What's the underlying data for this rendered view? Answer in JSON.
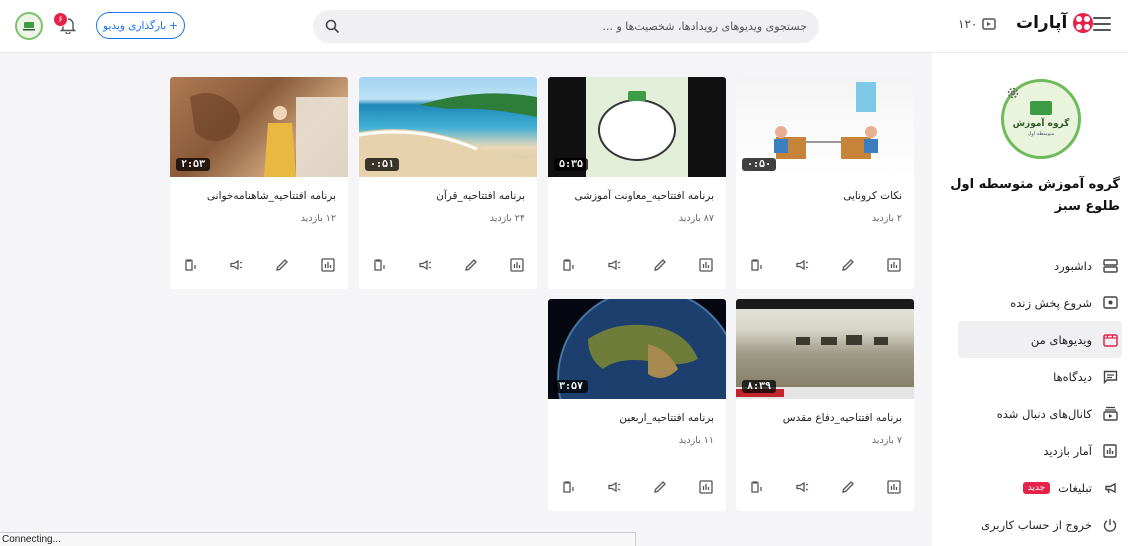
{
  "header": {
    "logo_text": "آپارات",
    "credit": "۱۲۰",
    "search_placeholder": "جستجوی ویدیوهای رویدادها، شخصیت‌ها و ...",
    "upload_label": "بارگذاری ویدیو",
    "notification_count": "۶"
  },
  "channel": {
    "name": "گروه آموزش متوسطه اول طلوع سبز",
    "avatar_title": "گروه آموزش",
    "avatar_sub": "متوسطه اول"
  },
  "menu": [
    {
      "label": "داشبورد",
      "icon": "dashboard-icon",
      "active": false
    },
    {
      "label": "شروع پخش زنده",
      "icon": "live-icon",
      "active": false
    },
    {
      "label": "ویدیوهای من",
      "icon": "my-videos-icon",
      "active": true
    },
    {
      "label": "دیدگاه‌ها",
      "icon": "comments-icon",
      "active": false
    },
    {
      "label": "کانال‌های دنبال شده",
      "icon": "subscriptions-icon",
      "active": false
    },
    {
      "label": "آمار بازدید",
      "icon": "stats-icon",
      "active": false
    },
    {
      "label": "تبلیغات",
      "icon": "ads-icon",
      "active": false,
      "badge": "جدید"
    },
    {
      "label": "خروج از حساب کاربری",
      "icon": "logout-icon",
      "active": false
    }
  ],
  "videos": [
    {
      "title": "نکات کرونایی",
      "views": "۲ بازدید",
      "duration": "۰:۵۰"
    },
    {
      "title": "برنامه افتتاحیه_معاونت آموزشی",
      "views": "۸۷ بازدید",
      "duration": "۵:۳۵"
    },
    {
      "title": "برنامه افتتاحیه_قرآن",
      "views": "۲۴ بازدید",
      "duration": "۰:۵۱"
    },
    {
      "title": "برنامه افتتاحیه_شاهنامه‌خوانی",
      "views": "۱۲ بازدید",
      "duration": "۲:۵۳"
    },
    {
      "title": "برنامه افتتاحیه_دفاع مقدس",
      "views": "۷ بازدید",
      "duration": "۸:۳۹"
    },
    {
      "title": "برنامه افتتاحیه_اربعین",
      "views": "۱۱ بازدید",
      "duration": "۳:۵۷"
    }
  ],
  "status_bar": "Connecting..."
}
